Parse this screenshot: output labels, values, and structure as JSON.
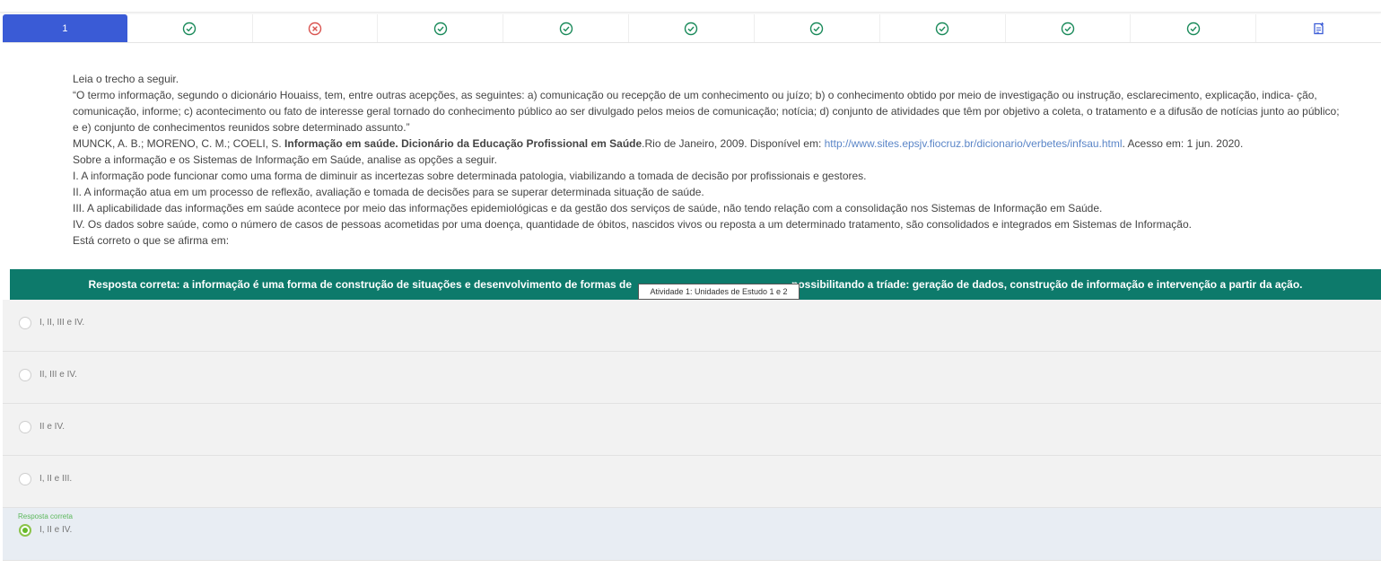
{
  "tabs": [
    {
      "label": "1",
      "status": "active"
    },
    {
      "label": "",
      "status": "correct"
    },
    {
      "label": "",
      "status": "wrong"
    },
    {
      "label": "",
      "status": "correct"
    },
    {
      "label": "",
      "status": "correct"
    },
    {
      "label": "",
      "status": "correct"
    },
    {
      "label": "",
      "status": "correct"
    },
    {
      "label": "",
      "status": "correct"
    },
    {
      "label": "",
      "status": "correct"
    },
    {
      "label": "",
      "status": "correct"
    },
    {
      "label": "",
      "status": "note"
    }
  ],
  "colors": {
    "active_tab": "#3a5bd6",
    "correct": "#1a8a5a",
    "wrong": "#d9534f",
    "banner": "#0d7a6b",
    "note_icon": "#3a5bd6"
  },
  "question": {
    "intro": "Leia o trecho a seguir.",
    "quote": "“O termo informação, segundo o dicionário Houaiss, tem, entre outras acepções, as seguintes: a) comunicação ou recepção de um conhecimento ou juízo; b) o conhecimento obtido por meio de investigação ou instrução, esclarecimento, explicação, indica- ção, comunicação, informe; c) acontecimento ou fato de interesse geral tornado do conhecimento público ao ser divulgado pelos meios de comunicação; notícia; d) conjunto de atividades que têm por objetivo a coleta, o tratamento e a difusão de notícias junto ao público; e e) conjunto de conhecimentos reunidos sobre determinado assunto.”",
    "ref_prefix": "MUNCK, A. B.; MORENO, C. M.; COELI, S. ",
    "ref_bold": "Informação em saúde. Dicionário da Educação Profissional em Saúde",
    "ref_mid": ".Rio de Janeiro, 2009. Disponível em: ",
    "ref_link": "http://www.sites.epsjv.fiocruz.br/dicionario/verbetes/infsau.html",
    "ref_suffix": ". Acesso em: 1 jun. 2020.",
    "prompt": "Sobre a informação e os Sistemas de Informação em Saúde, analise as opções a seguir.",
    "statements": [
      "I. A informação pode funcionar como uma forma de diminuir as incertezas sobre determinada patologia, viabilizando a tomada de decisão por profissionais e gestores.",
      "II. A informação atua em um processo de reflexão, avaliação e tomada de decisões para se superar determinada situação de saúde.",
      "III. A aplicabilidade das informações em saúde acontece por meio das informações epidemiológicas e da gestão dos serviços de saúde, não tendo relação com a consolidação nos Sistemas de Informação em Saúde.",
      "IV. Os dados sobre saúde, como o número de casos de pessoas acometidas por uma doença, quantidade de óbitos, nascidos vivos ou reposta a um determinado tratamento, são consolidados e integrados em Sistemas de Informação."
    ],
    "closing": "Está correto o que se afirma em:"
  },
  "banner": {
    "left": "Resposta correta: a informação é uma forma de construção de situações e desenvolvimento de formas de",
    "right": "possibilitando a tríade: geração de dados, construção de informação e intervenção a partir da ação."
  },
  "tooltip": "Atividade 1: Unidades de Estudo 1 e 2",
  "options": [
    {
      "label": "I, II, III e IV."
    },
    {
      "label": "II, III e IV."
    },
    {
      "label": "II e IV."
    },
    {
      "label": "I, II e III."
    },
    {
      "label": "I, II e IV.",
      "tag": "Resposta correta",
      "selected": true
    }
  ]
}
